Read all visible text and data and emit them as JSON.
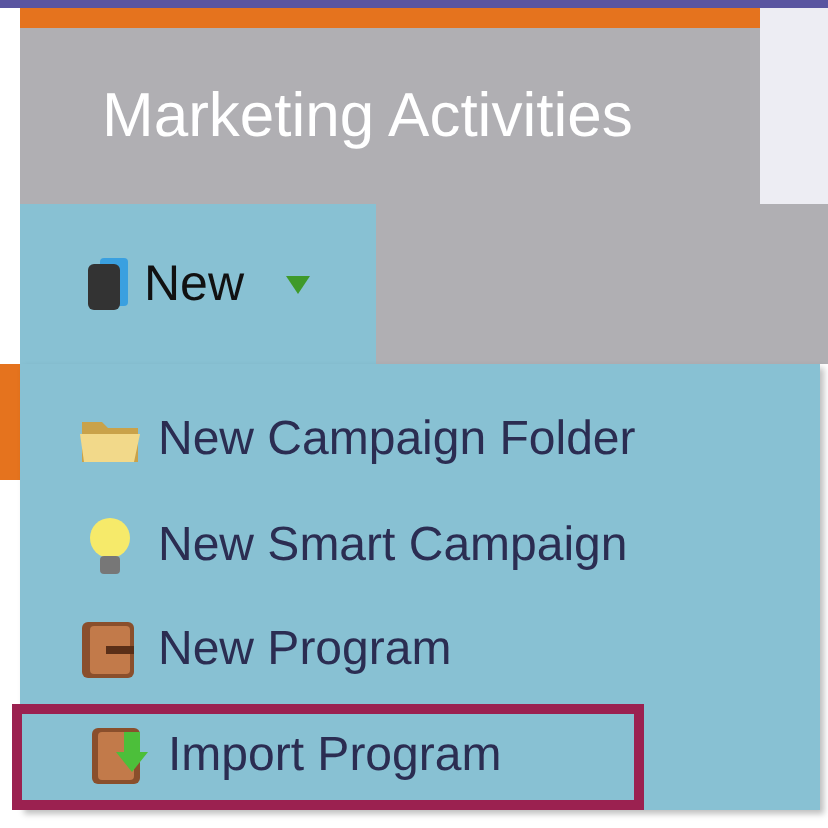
{
  "header": {
    "title": "Marketing Activities"
  },
  "toolbar": {
    "new_button": {
      "label": "New",
      "expanded": true
    }
  },
  "menu": {
    "items": [
      {
        "kind": "folder",
        "label": "New Campaign Folder",
        "highlighted": false
      },
      {
        "kind": "bulb",
        "label": "New Smart Campaign",
        "highlighted": false
      },
      {
        "kind": "program",
        "label": "New Program",
        "highlighted": false
      },
      {
        "kind": "import",
        "label": "Import Program",
        "highlighted": true
      }
    ]
  }
}
